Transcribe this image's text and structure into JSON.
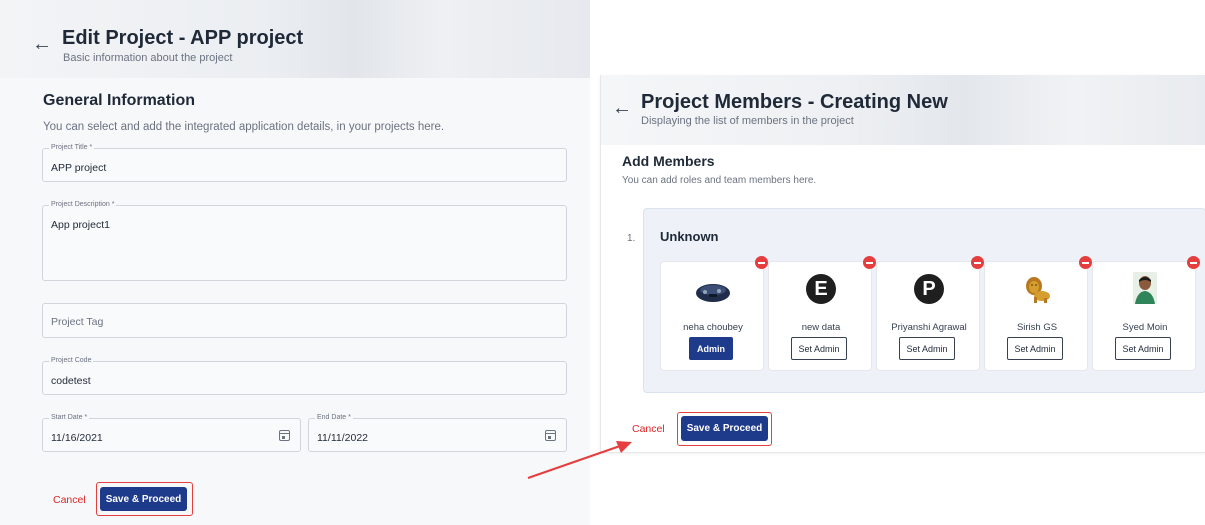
{
  "edit_project": {
    "title": "Edit Project - APP project",
    "subtitle": "Basic information about the project",
    "section_title": "General Information",
    "section_desc": "You can select and add the integrated application details, in your projects here.",
    "fields": {
      "title": {
        "label": "Project Title *",
        "value": "APP project"
      },
      "description": {
        "label": "Project Description *",
        "value": "App project1"
      },
      "tag": {
        "placeholder": "Project Tag"
      },
      "code": {
        "label": "Project Code",
        "value": "codetest"
      },
      "start_date": {
        "label": "Start Date *",
        "value": "11/16/2021"
      },
      "end_date": {
        "label": "End Date *",
        "value": "11/11/2022"
      }
    },
    "cancel_label": "Cancel",
    "save_label": "Save & Proceed"
  },
  "project_members": {
    "title": "Project Members - Creating New",
    "subtitle": "Displaying the list of members in the project",
    "section_title": "Add Members",
    "section_desc": "You can add roles and team members here.",
    "row_index": "1.",
    "group_name": "Unknown",
    "members": [
      {
        "name": "neha choubey",
        "role_label": "Admin",
        "is_admin": true,
        "avatar": "photo"
      },
      {
        "name": "new data",
        "role_label": "Set Admin",
        "is_admin": false,
        "avatar": "E"
      },
      {
        "name": "Priyanshi Agrawal",
        "role_label": "Set Admin",
        "is_admin": false,
        "avatar": "P"
      },
      {
        "name": "Sirish GS",
        "role_label": "Set Admin",
        "is_admin": false,
        "avatar": "lion-icon"
      },
      {
        "name": "Syed Moin",
        "role_label": "Set Admin",
        "is_admin": false,
        "avatar": "photo"
      }
    ],
    "cancel_label": "Cancel",
    "save_label": "Save & Proceed"
  },
  "colors": {
    "primary": "#1e3a8a",
    "danger": "#e53e3e",
    "cancel_text": "#dc2626"
  }
}
